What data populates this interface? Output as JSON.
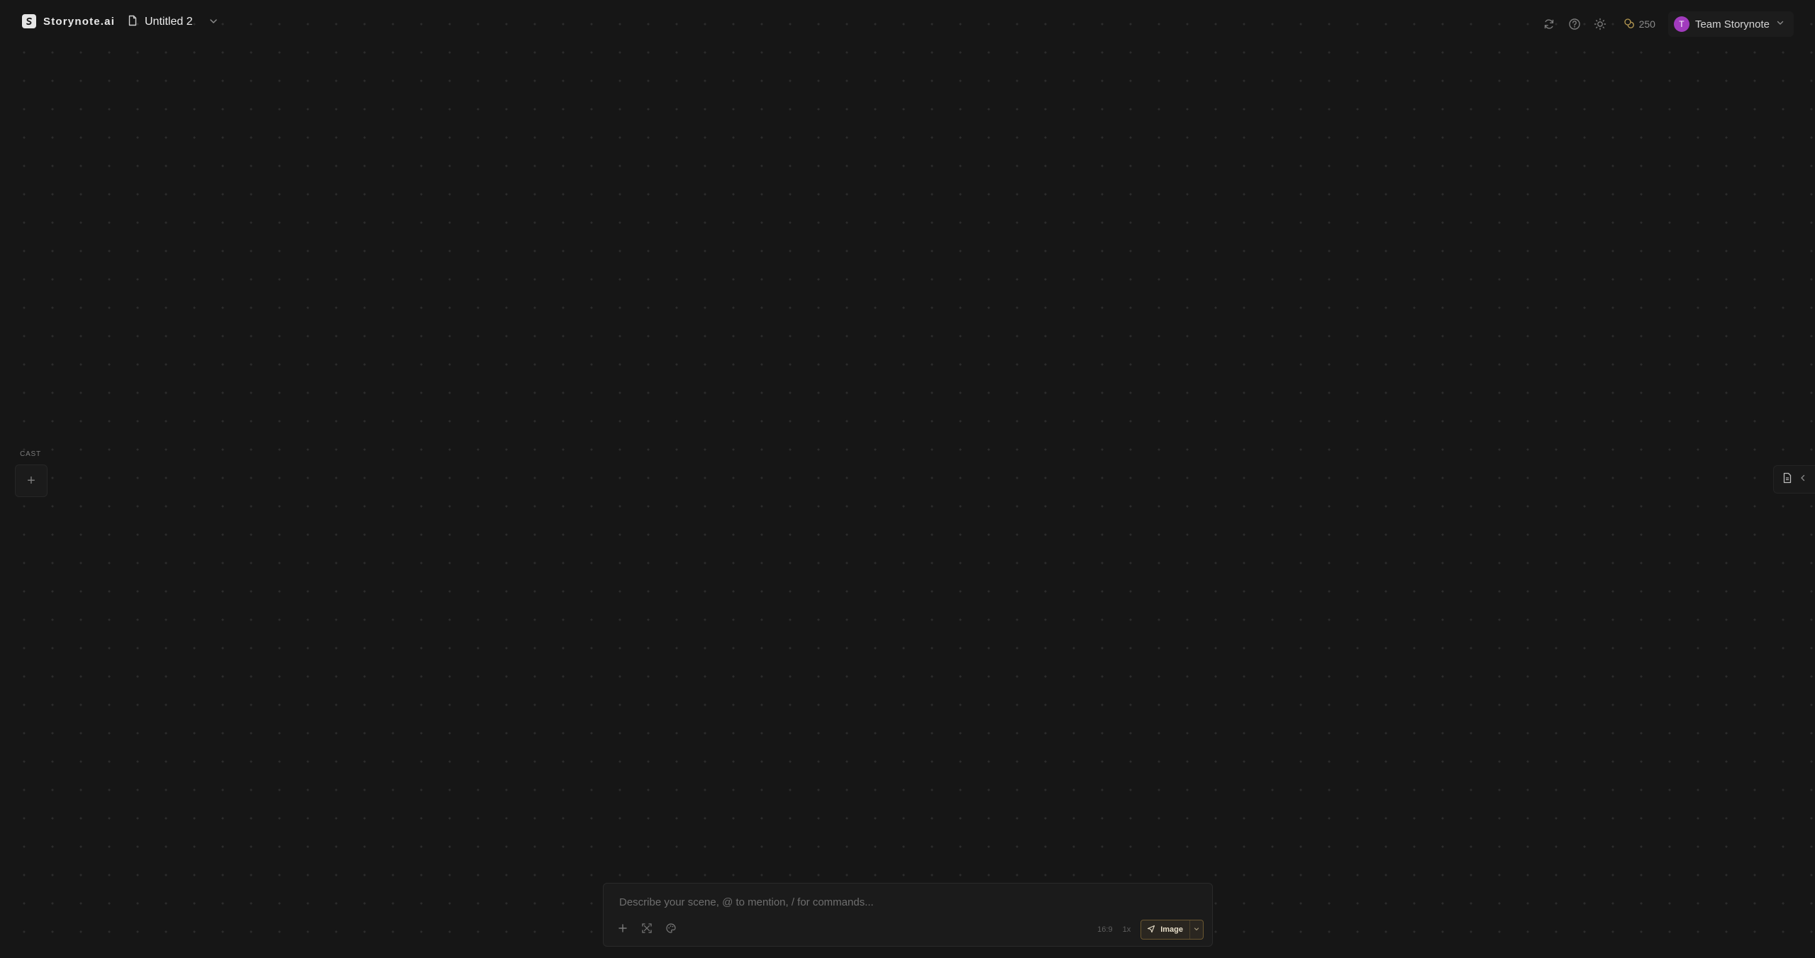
{
  "app": {
    "name": "Storynote.ai",
    "document_title": "Untitled 2"
  },
  "header": {
    "credits": "250",
    "team_initial": "T",
    "team_name": "Team Storynote",
    "icons": [
      "refresh-icon",
      "help-icon",
      "theme-sun-icon",
      "credits-icon",
      "chevron-down-icon"
    ]
  },
  "cast": {
    "label": "CAST",
    "add_symbol": "+"
  },
  "prompt": {
    "placeholder": "Describe your scene, @ to mention, / for commands...",
    "value": "",
    "aspect_ratio": "16:9",
    "count": "1x",
    "generate_label": "Image"
  },
  "colors": {
    "background": "#161616",
    "avatar": "#a13bbd",
    "accent_border": "#6a5630"
  }
}
